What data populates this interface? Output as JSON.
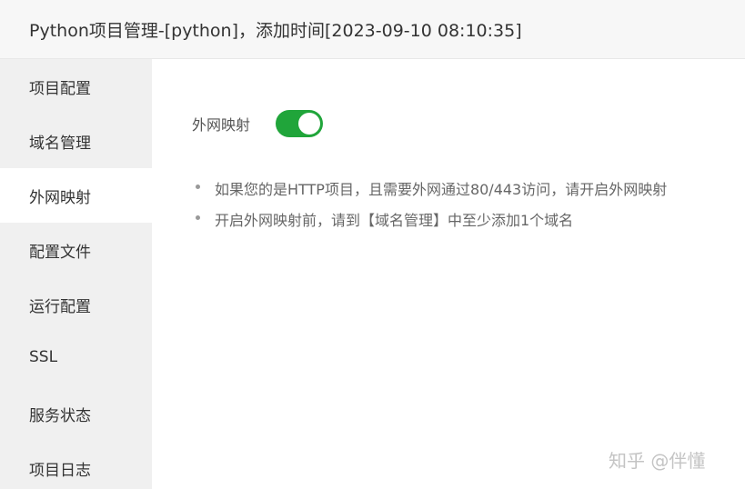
{
  "window": {
    "title": "Python项目管理-[python]，添加时间[2023-09-10 08:10:35]"
  },
  "sidebar": {
    "items": [
      {
        "label": "项目配置"
      },
      {
        "label": "域名管理"
      },
      {
        "label": "外网映射",
        "active": true
      },
      {
        "label": "配置文件"
      },
      {
        "label": "运行配置"
      },
      {
        "label": "SSL"
      },
      {
        "label": "服务状态"
      },
      {
        "label": "项目日志"
      }
    ]
  },
  "main": {
    "toggle": {
      "label": "外网映射",
      "on": true
    },
    "tips": [
      "如果您的是HTTP项目，且需要外网通过80/443访问，请开启外网映射",
      "开启外网映射前，请到【域名管理】中至少添加1个域名"
    ]
  },
  "watermark": "知乎 @伴懂",
  "colors": {
    "accent": "#20a53a",
    "sidebar_bg": "#f0f0f0",
    "titlebar_bg": "#f7f7f7"
  }
}
